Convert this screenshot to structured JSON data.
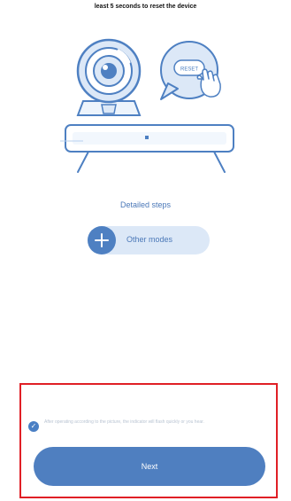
{
  "instruction": {
    "text": "least 5 seconds to reset the device"
  },
  "illustration": {
    "button_text": "RESET"
  },
  "steps": {
    "label": "Detailed steps"
  },
  "modes": {
    "label": "Other modes"
  },
  "confirm": {
    "checked": true,
    "text": "After operating according to the picture, the indicator will flash quickly or you hear."
  },
  "next_button": {
    "label": "Next"
  },
  "colors": {
    "accent": "#4f7fc0",
    "light_accent": "#dce8f7",
    "highlight_border": "#e01f26"
  }
}
